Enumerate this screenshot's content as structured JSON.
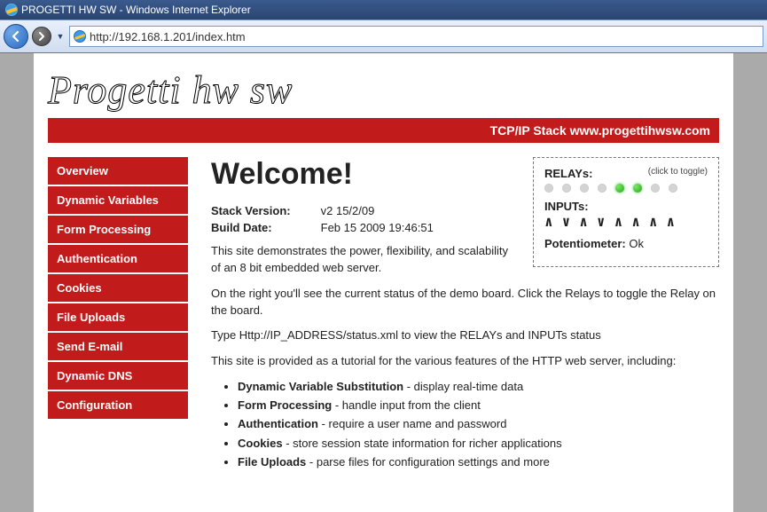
{
  "window": {
    "title": "PROGETTI HW SW - Windows Internet Explorer"
  },
  "address_bar": {
    "url": "http://192.168.1.201/index.htm"
  },
  "logo_text": "Progetti hw sw",
  "header_strip": "TCP/IP Stack www.progettihwsw.com",
  "menu": {
    "items": [
      "Overview",
      "Dynamic Variables",
      "Form Processing",
      "Authentication",
      "Cookies",
      "File Uploads",
      "Send E-mail",
      "Dynamic DNS",
      "Configuration"
    ]
  },
  "content": {
    "heading": "Welcome!",
    "stack_version_label": "Stack Version:",
    "stack_version_value": "v2 15/2/09",
    "build_date_label": "Build Date:",
    "build_date_value": "Feb 15 2009 19:46:51",
    "para1": "This site demonstrates the power, flexibility, and scalability of an 8 bit embedded web server.",
    "para2": "On the right you'll see the current status of the demo board. Click the Relays to toggle the Relay on the board.",
    "para3": "Type Http://IP_ADDRESS/status.xml to view the RELAYs and INPUTs status",
    "para4": "This site is provided as a tutorial for the various features of the HTTP web server, including:",
    "features": [
      {
        "bold": "Dynamic Variable Substitution",
        "text": " - display real-time data"
      },
      {
        "bold": "Form Processing",
        "text": " - handle input from the client"
      },
      {
        "bold": "Authentication",
        "text": " - require a user name and password"
      },
      {
        "bold": "Cookies",
        "text": " - store session state information for richer applications"
      },
      {
        "bold": "File Uploads",
        "text": " - parse files for configuration settings and more"
      }
    ]
  },
  "status": {
    "relays_label": "RELAYs:",
    "relays_hint": "(click to toggle)",
    "relays": [
      false,
      false,
      false,
      false,
      true,
      true,
      false,
      false
    ],
    "inputs_label": "INPUTs:",
    "inputs": [
      "∧",
      "∨",
      "∧",
      "∨",
      "∧",
      "∧",
      "∧",
      "∧"
    ],
    "pot_label": "Potentiometer:",
    "pot_value": "Ok"
  }
}
